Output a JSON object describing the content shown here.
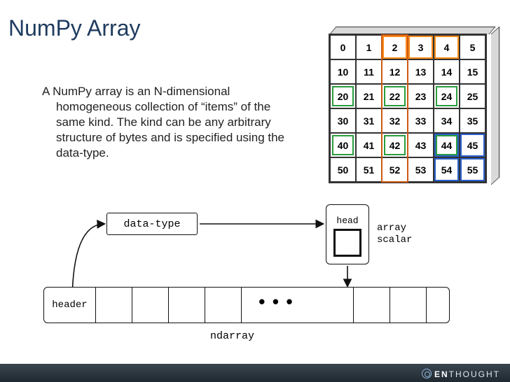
{
  "title": "NumPy Array",
  "description": "A NumPy array is an N-dimensional homogeneous collection of “items” of the same kind.  The kind can be any arbitrary structure of bytes and is specified using the data-type.",
  "grid": {
    "rows": [
      [
        0,
        1,
        2,
        3,
        4,
        5
      ],
      [
        10,
        11,
        12,
        13,
        14,
        15
      ],
      [
        20,
        21,
        22,
        23,
        24,
        25
      ],
      [
        30,
        31,
        32,
        33,
        34,
        35
      ],
      [
        40,
        41,
        42,
        43,
        44,
        45
      ],
      [
        50,
        51,
        52,
        53,
        54,
        55
      ]
    ],
    "orange_cells": [
      [
        0,
        2
      ],
      [
        0,
        3
      ],
      [
        0,
        4
      ]
    ],
    "blue_cells": [
      [
        4,
        4
      ],
      [
        4,
        5
      ],
      [
        5,
        4
      ],
      [
        5,
        5
      ]
    ],
    "green_cells": [
      [
        2,
        0
      ],
      [
        2,
        2
      ],
      [
        2,
        4
      ],
      [
        4,
        0
      ],
      [
        4,
        2
      ],
      [
        4,
        4
      ]
    ],
    "column_outline": 2
  },
  "diagram": {
    "datatype_label": "data-type",
    "head_label": "head",
    "array_scalar_label_1": "array",
    "array_scalar_label_2": "scalar",
    "header_label": "header",
    "ndarray_label": "ndarray",
    "dots": "•••"
  },
  "footer": {
    "brand_bold": "EN",
    "brand_rest": "THOUGHT"
  }
}
